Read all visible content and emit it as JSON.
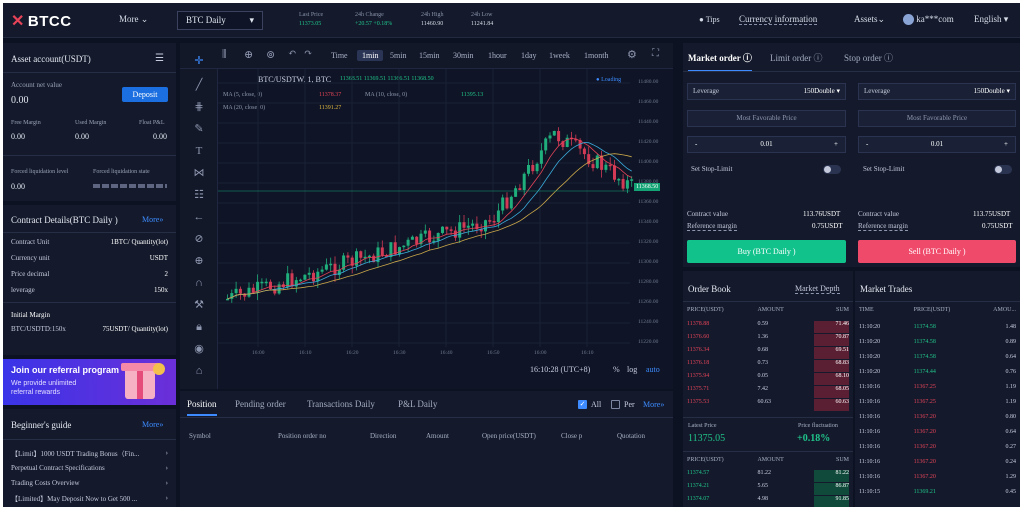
{
  "header": {
    "logo": "BTCC",
    "more": "More",
    "symbol": "BTC Daily",
    "stats": [
      {
        "label": "Last Price",
        "value": "11373.05",
        "green": true
      },
      {
        "label": "24h Change",
        "value": "+20.57 +0.18%",
        "green": true
      },
      {
        "label": "24h High",
        "value": "11460.90",
        "green": false
      },
      {
        "label": "24h Low",
        "value": "11241.84",
        "green": false
      }
    ],
    "tips": "Tips",
    "currency_info": "Currency information",
    "assets": "Assets",
    "user": "ka***com",
    "language": "English"
  },
  "asset": {
    "title": "Asset account(USDT)",
    "net_value_label": "Account net value",
    "net_value": "0.00",
    "deposit": "Deposit",
    "free_margin_label": "Free Margin",
    "free_margin": "0.00",
    "used_margin_label": "Used Margin",
    "used_margin": "0.00",
    "float_pl_label": "Float P&L",
    "float_pl": "0.00",
    "forced_level_label": "Forced liquidation level",
    "forced_level": "0.00",
    "forced_state_label": "Forced liquidation state"
  },
  "contract": {
    "title": "Contract Details(BTC Daily )",
    "more": "More",
    "rows": [
      {
        "k": "Contract Unit",
        "v": "1BTC/ Quantity(lot)"
      },
      {
        "k": "Currency unit",
        "v": "USDT"
      },
      {
        "k": "Price decimal",
        "v": "2"
      },
      {
        "k": "leverage",
        "v": "150x"
      }
    ],
    "initial_margin_label": "Initial Margin",
    "initial_margin_key": "BTC/USDTD:150x",
    "initial_margin_value": "75USDT/ Quantity(lot)"
  },
  "referral": {
    "title": "Join our referral program",
    "line1": "We provide unlimited",
    "line2": "referral rewards"
  },
  "guide": {
    "title": "Beginner's guide",
    "more": "More",
    "items": [
      "【Limit】1000 USDT Trading Bonus（Fin...",
      "Perpetual Contract Specifications",
      "Trading Costs Overview",
      "【Limited】May Deposit Now to Get 500 ..."
    ]
  },
  "chart": {
    "timeframes": [
      "Time",
      "1min",
      "5min",
      "15min",
      "30min",
      "1hour",
      "1day",
      "1week",
      "1month"
    ],
    "active_timeframe": "1min",
    "legend_main": "BTC/USDTW, 1, BTC",
    "legend_ohlc": "11368.51  11369.51  11366.51  11368.50",
    "ma1": "MA (5, close, 0)",
    "ma1_val": "11378.37",
    "ma2": "MA (10, close, 0)",
    "ma2_val": "11395.13",
    "ma3": "MA (20, close, 0)",
    "ma3_val": "11391.27",
    "loading": "Loading",
    "price_tag": "11368.50",
    "y_ticks": [
      "11480.00",
      "11460.00",
      "11440.00",
      "11420.00",
      "11400.00",
      "11380.00",
      "11360.00",
      "11340.00",
      "11320.00",
      "11300.00",
      "11280.00",
      "11260.00",
      "11240.00",
      "11220.00"
    ],
    "x_ticks": [
      "16:00",
      "16:10",
      "16:20",
      "16:30",
      "16:40",
      "16:50",
      "16:00",
      "16:10"
    ],
    "clock": "16:10:28 (UTC+8)",
    "pct": "%",
    "log": "log",
    "auto": "auto"
  },
  "positions": {
    "tabs": [
      "Position",
      "Pending order",
      "Transactions Daily",
      "P&L Daily"
    ],
    "all": "All",
    "per": "Per",
    "more": "More",
    "columns": [
      "Symbol",
      "Position order no",
      "Direction",
      "Amount",
      "Open price(USDT)",
      "Close p",
      "Quotation"
    ]
  },
  "order": {
    "tabs": [
      "Market order",
      "Limit order",
      "Stop order"
    ],
    "leverage_label": "Leverage",
    "leverage_value": "150Double",
    "most_favorable": "Most Favorable Price",
    "qty": "0.01",
    "minus": "-",
    "plus": "+",
    "stop_limit": "Set Stop-Limit",
    "contract_value_label": "Contract value",
    "contract_value_buy": "113.76USDT",
    "contract_value_sell": "113.75USDT",
    "ref_margin_label": "Reference margin",
    "ref_margin": "0.75USDT",
    "buy": "Buy (BTC Daily )",
    "sell": "Sell (BTC Daily )"
  },
  "book": {
    "title": "Order Book",
    "depth": "Market Depth",
    "headers": [
      "PRICE(USDT)",
      "AMOUNT",
      "SUM"
    ],
    "asks": [
      [
        "11378.88",
        "0.59",
        "71.46"
      ],
      [
        "11376.60",
        "1.36",
        "70.87"
      ],
      [
        "11376.34",
        "0.68",
        "69.51"
      ],
      [
        "11376.18",
        "0.73",
        "68.83"
      ],
      [
        "11375.94",
        "0.05",
        "68.10"
      ],
      [
        "11375.71",
        "7.42",
        "68.05"
      ],
      [
        "11375.53",
        "60.63",
        "60.63"
      ]
    ],
    "latest_label": "Latest Price",
    "latest": "11375.05",
    "fluct_label": "Price fluctuation",
    "fluct": "+0.18%",
    "bids": [
      [
        "11374.57",
        "81.22",
        "81.22"
      ],
      [
        "11374.21",
        "5.65",
        "86.87"
      ],
      [
        "11374.07",
        "4.98",
        "91.85"
      ]
    ]
  },
  "trades": {
    "title": "Market Trades",
    "headers": [
      "TIME",
      "PRICE(USDT)",
      "AMOU..."
    ],
    "rows": [
      [
        "11:10:20",
        "11374.58",
        "1.48",
        "g"
      ],
      [
        "11:10:20",
        "11374.58",
        "0.89",
        "g"
      ],
      [
        "11:10:20",
        "11374.58",
        "0.64",
        "g"
      ],
      [
        "11:10:20",
        "11374.44",
        "0.76",
        "g"
      ],
      [
        "11:10:16",
        "11367.25",
        "1.19",
        "r"
      ],
      [
        "11:10:16",
        "11367.25",
        "1.19",
        "r"
      ],
      [
        "11:10:16",
        "11367.20",
        "0.80",
        "r"
      ],
      [
        "11:10:16",
        "11367.20",
        "0.64",
        "r"
      ],
      [
        "11:10:16",
        "11367.20",
        "0.27",
        "r"
      ],
      [
        "11:10:16",
        "11367.20",
        "0.24",
        "r"
      ],
      [
        "11:10:16",
        "11367.20",
        "1.29",
        "r"
      ],
      [
        "11:10:15",
        "11369.21",
        "0.45",
        "g"
      ]
    ]
  },
  "colors": {
    "accent": "#3d8bff",
    "buy": "#20c48a",
    "sell": "#f04a6b",
    "bg": "#0d1222"
  }
}
